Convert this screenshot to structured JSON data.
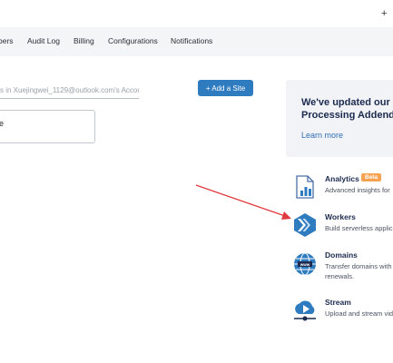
{
  "topbar": {
    "plus_label": "+ ."
  },
  "nav": {
    "tabs": [
      {
        "label": "bers"
      },
      {
        "label": "Audit Log"
      },
      {
        "label": "Billing"
      },
      {
        "label": "Configurations"
      },
      {
        "label": "Notifications"
      }
    ]
  },
  "search": {
    "placeholder": "s in Xuejingwei_1129@outlook.com's Accour"
  },
  "add_site": {
    "label": "+ Add a Site"
  },
  "box": {
    "text": "e"
  },
  "update_card": {
    "title": "We've updated our D Processing Addendu",
    "link": "Learn more"
  },
  "products": [
    {
      "title": "Analytics",
      "badge": "Beta",
      "desc": "Advanced insights for",
      "icon": "analytics-icon"
    },
    {
      "title": "Workers",
      "desc": "Build serverless applic",
      "icon": "workers-icon"
    },
    {
      "title": "Domains",
      "desc": "Transfer domains with\nrenewals.",
      "icon": "globe-icon"
    },
    {
      "title": "Stream",
      "desc": "Upload and stream vid",
      "icon": "stream-icon"
    }
  ],
  "colors": {
    "accent": "#2f7bbf",
    "badge": "#f6a253",
    "annotation_arrow": "#e0393e",
    "nav_bg": "#f4f5f7"
  }
}
